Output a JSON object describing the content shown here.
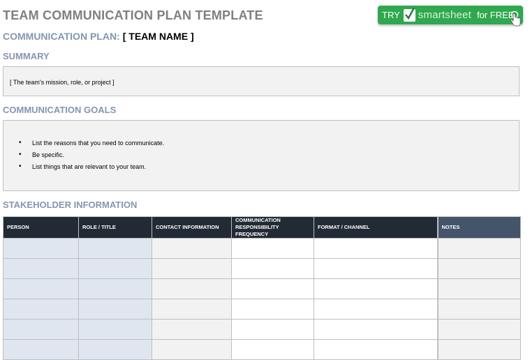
{
  "document": {
    "title": "TEAM COMMUNICATION PLAN TEMPLATE",
    "plan_label": "COMMUNICATION PLAN:",
    "plan_value": "[ TEAM NAME ]"
  },
  "cta": {
    "try_label": "TRY",
    "brand": "smartsheet",
    "free_label": "for FREE",
    "colors": {
      "background": "#2fa84f",
      "text": "#ffffff"
    },
    "icons": [
      "checkmark-icon",
      "hand-cursor-icon"
    ]
  },
  "summary": {
    "heading": "SUMMARY",
    "text": "[ The team's mission, role, or project ]"
  },
  "goals": {
    "heading": "COMMUNICATION GOALS",
    "items": [
      "List the reasons that you need to communicate.",
      "Be specific.",
      "List things that are relevant to your team."
    ]
  },
  "stakeholders": {
    "heading": "STAKEHOLDER INFORMATION",
    "columns": [
      "PERSON",
      "ROLE / TITLE",
      "CONTACT INFORMATION",
      "COMMUNICATION RESPONSIBILITY FREQUENCY",
      "FORMAT / CHANNEL",
      "NOTES"
    ],
    "rows": [
      [
        "",
        "",
        "",
        "",
        "",
        ""
      ],
      [
        "",
        "",
        "",
        "",
        "",
        ""
      ],
      [
        "",
        "",
        "",
        "",
        "",
        ""
      ],
      [
        "",
        "",
        "",
        "",
        "",
        ""
      ],
      [
        "",
        "",
        "",
        "",
        "",
        ""
      ],
      [
        "",
        "",
        "",
        "",
        "",
        ""
      ]
    ],
    "colors": {
      "header": "#222b35",
      "notes_header": "#44546a",
      "accent_text": "#8496b0"
    }
  }
}
